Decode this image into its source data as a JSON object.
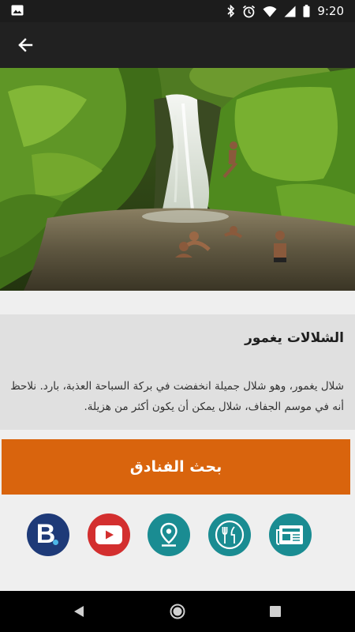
{
  "status_bar": {
    "time": "9:20",
    "icons": [
      "image-icon",
      "bluetooth-icon",
      "alarm-icon",
      "wifi-icon",
      "signal-icon",
      "battery-icon"
    ]
  },
  "app_bar": {
    "back_icon": "arrow-back-icon"
  },
  "hero": {
    "icon": "waterfall-photo"
  },
  "place": {
    "title": "الشلالات يغمور",
    "description": "شلال يغمور، وهو شلال جميلة انخفضت في بركة السباحة العذبة، بارد. نلاحظ أنه في موسم الجفاف، شلال يمكن أن يكون أكثر من هزيلة."
  },
  "actions": {
    "search_hotels": "بحث الفنادق"
  },
  "share_icons": [
    {
      "name": "booking-icon",
      "color": "#1e3a78"
    },
    {
      "name": "youtube-icon",
      "color": "#d32f2f"
    },
    {
      "name": "location-pin-icon",
      "color": "#1a8c92"
    },
    {
      "name": "restaurant-icon",
      "color": "#1a8c92"
    },
    {
      "name": "newspaper-icon",
      "color": "#1a8c92"
    }
  ],
  "colors": {
    "accent": "#d9640d",
    "teal": "#1a8c92",
    "app_bar": "#212121"
  },
  "nav_bar": {
    "icons": [
      "back-triangle-icon",
      "home-circle-icon",
      "recents-square-icon"
    ]
  }
}
